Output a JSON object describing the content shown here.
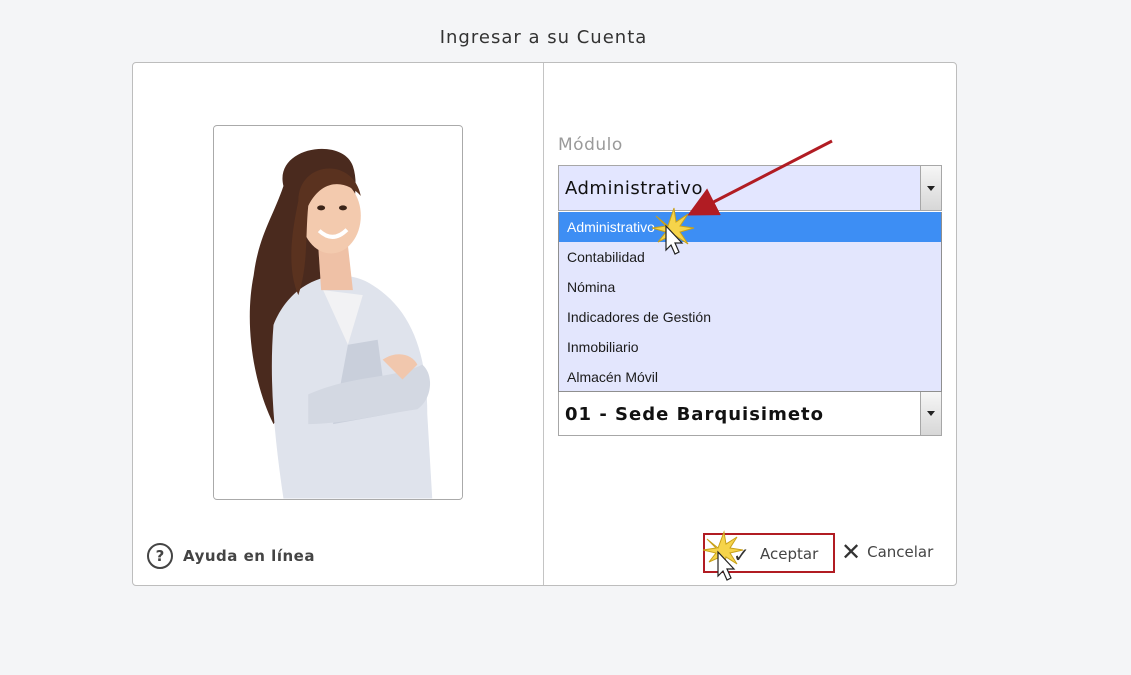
{
  "page": {
    "title": "Ingresar a su Cuenta"
  },
  "help": {
    "label": "Ayuda en línea",
    "icon": "question-circle-icon"
  },
  "module": {
    "label": "Módulo",
    "selected": "Administrativo",
    "options": [
      {
        "label": "Administrativo",
        "selected": true
      },
      {
        "label": "Contabilidad",
        "selected": false
      },
      {
        "label": "Nómina",
        "selected": false
      },
      {
        "label": "Indicadores de Gestión",
        "selected": false
      },
      {
        "label": "Inmobiliario",
        "selected": false
      },
      {
        "label": "Almacén Móvil",
        "selected": false
      }
    ]
  },
  "branch": {
    "selected": "01 - Sede Barquisimeto"
  },
  "actions": {
    "accept_label": "Aceptar",
    "accept_icon": "checkmark-icon",
    "cancel_label": "Cancelar",
    "cancel_icon": "close-icon"
  },
  "colors": {
    "highlight": "#3d8ef4",
    "dropdown_bg": "#e3e6fd",
    "annotation_red": "#b11c23"
  }
}
